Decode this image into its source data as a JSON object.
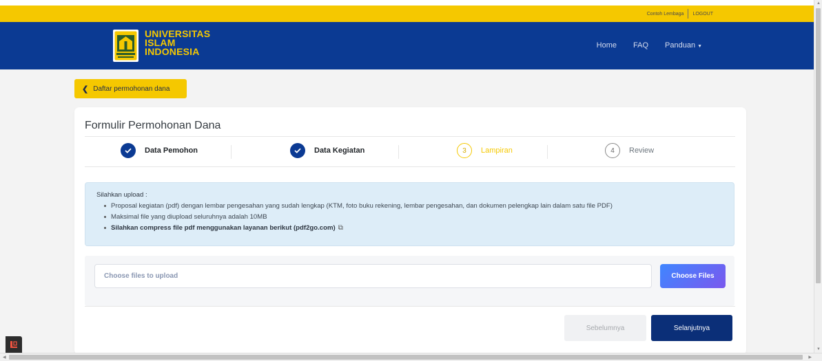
{
  "topbar": {
    "org_link": "Contoh Lembaga",
    "logout": "LOGOUT"
  },
  "brand": {
    "line1": "UNIVERSITAS",
    "line2": "ISLAM",
    "line3": "INDONESIA"
  },
  "nav": {
    "home": "Home",
    "faq": "FAQ",
    "panduan": "Panduan"
  },
  "back_button": {
    "label": "Daftar permohonan dana"
  },
  "form": {
    "title": "Formulir Permohonan Dana",
    "steps": [
      {
        "number": "1",
        "label": "Data Pemohon",
        "status": "done"
      },
      {
        "number": "2",
        "label": "Data Kegiatan",
        "status": "done"
      },
      {
        "number": "3",
        "label": "Lampiran",
        "status": "current"
      },
      {
        "number": "4",
        "label": "Review",
        "status": "todo"
      }
    ],
    "notice": {
      "title": "Silahkan upload :",
      "items": [
        "Proposal kegiatan (pdf) dengan lembar pengesahan yang sudah lengkap (KTM, foto buku rekening, lembar pengesahan, dan dokumen pelengkap lain dalam satu file PDF)",
        "Maksimal file yang diupload seluruhnya adalah 10MB",
        "Silahkan compress file pdf menggunakan layanan berikut (pdf2go.com)"
      ]
    },
    "upload": {
      "placeholder": "Choose files to upload",
      "button": "Choose Files"
    },
    "buttons": {
      "previous": "Sebelumnya",
      "next": "Selanjutnya"
    }
  },
  "colors": {
    "yellow": "#f5c800",
    "navy": "#0b3a93",
    "dark_navy": "#0b2f78",
    "alert_bg": "#ddedf8"
  }
}
